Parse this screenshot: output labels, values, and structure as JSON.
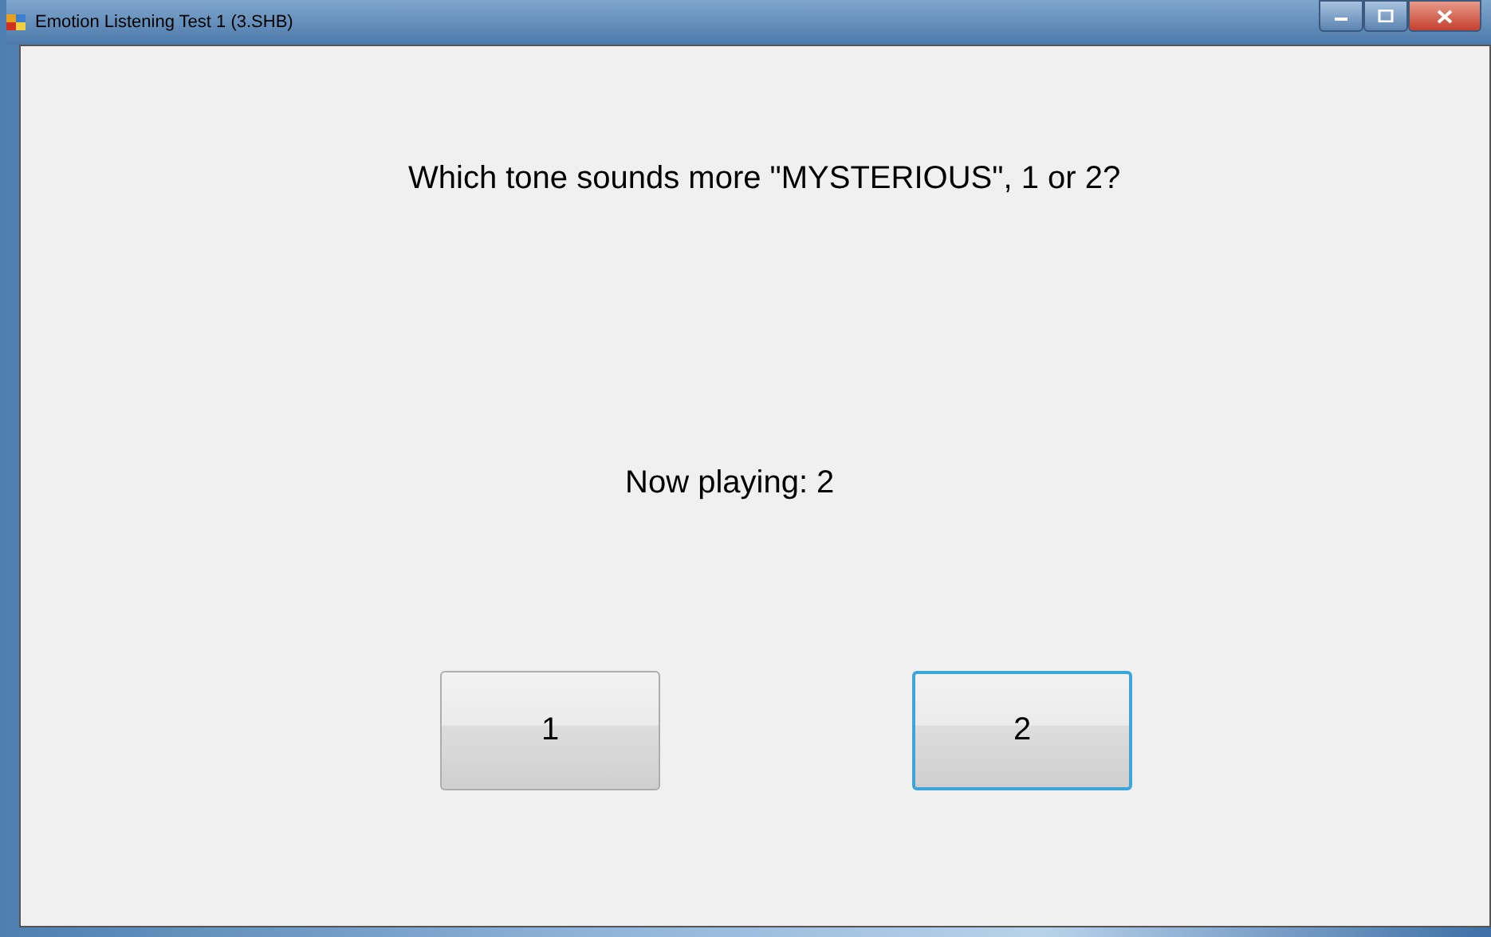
{
  "window": {
    "title": "Emotion Listening Test 1 (3.SHB)"
  },
  "question": "Which tone sounds more \"MYSTERIOUS\", 1 or 2?",
  "now_playing": "Now playing: 2",
  "buttons": [
    {
      "label": "1",
      "focused": false
    },
    {
      "label": "2",
      "focused": true
    }
  ]
}
